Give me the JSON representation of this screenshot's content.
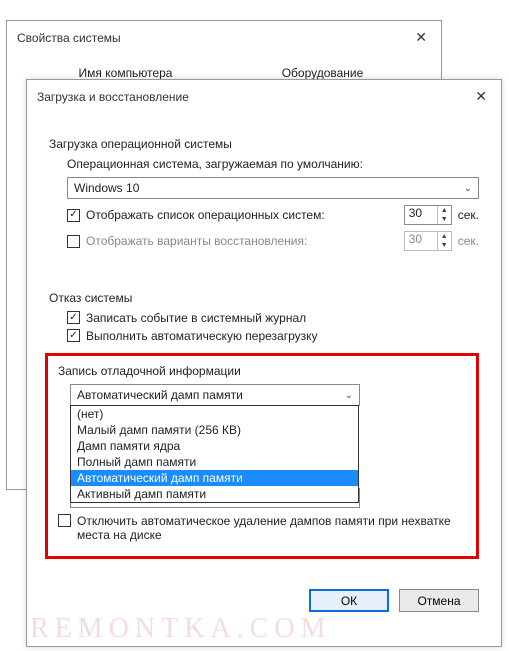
{
  "properties_window": {
    "title": "Свойства системы",
    "tabs": {
      "t1": "Имя компьютера",
      "t2": "Оборудование"
    }
  },
  "startup_window": {
    "title": "Загрузка и восстановление"
  },
  "boot": {
    "heading": "Загрузка операционной системы",
    "os_label": "Операционная система, загружаемая по умолчанию:",
    "os_value": "Windows 10",
    "show_list": {
      "checked": true,
      "label": "Отображать список операционных систем:",
      "value": "30",
      "unit": "сек."
    },
    "show_recovery": {
      "checked": false,
      "label": "Отображать варианты восстановления:",
      "value": "30",
      "unit": "сек."
    }
  },
  "failure": {
    "heading": "Отказ системы",
    "log_event": {
      "checked": true,
      "label": "Записать событие в системный журнал"
    },
    "auto_restart": {
      "checked": true,
      "label": "Выполнить автоматическую перезагрузку"
    }
  },
  "debug": {
    "heading": "Запись отладочной информации",
    "selected": "Автоматический дамп памяти",
    "options": {
      "o0": "(нет)",
      "o1": "Малый дамп памяти (256 КВ)",
      "o2": "Дамп памяти ядра",
      "o3": "Полный дамп памяти",
      "o4": "Автоматический дамп памяти",
      "o5": "Активный дамп памяти"
    },
    "disable_autodelete": {
      "checked": false,
      "label": "Отключить автоматическое удаление дампов памяти при нехватке места на диске"
    }
  },
  "buttons": {
    "ok": "ОК",
    "cancel": "Отмена"
  },
  "watermark": "REMONTKA.COM",
  "glyphs": {
    "check": "✓",
    "down": "⌄",
    "up": "▲",
    "dn": "▼",
    "close": "✕"
  }
}
